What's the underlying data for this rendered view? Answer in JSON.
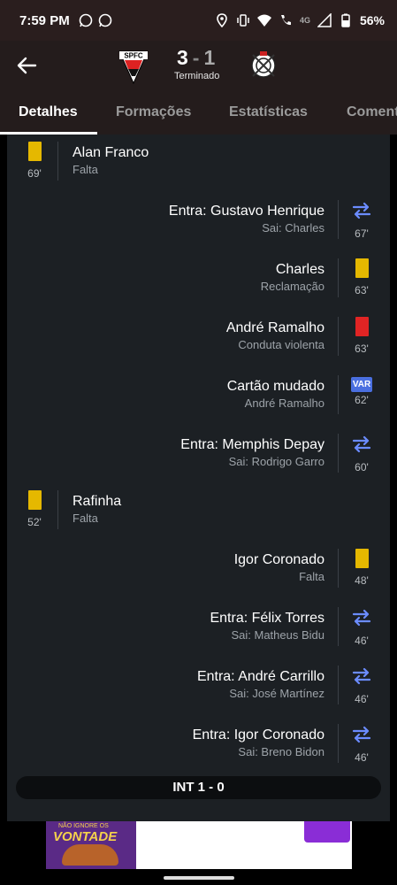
{
  "status_bar": {
    "time": "7:59 PM",
    "network": "4G",
    "battery": "56%"
  },
  "match": {
    "home_score": "3",
    "separator": "-",
    "away_score": "1",
    "status": "Terminado",
    "home_crest_text": "SPFC"
  },
  "tabs": [
    {
      "label": "Detalhes",
      "active": true
    },
    {
      "label": "Formações",
      "active": false
    },
    {
      "label": "Estatísticas",
      "active": false
    },
    {
      "label": "Comentários",
      "active": false
    }
  ],
  "events": [
    {
      "side": "left",
      "type": "yellow-card",
      "title": "Alan Franco",
      "sub": "Falta",
      "minute": "69'"
    },
    {
      "side": "right",
      "type": "substitution",
      "title": "Entra: Gustavo Henrique",
      "sub": "Sai: Charles",
      "minute": "67'"
    },
    {
      "side": "right",
      "type": "yellow-card",
      "title": "Charles",
      "sub": "Reclamação",
      "minute": "63'"
    },
    {
      "side": "right",
      "type": "red-card",
      "title": "André Ramalho",
      "sub": "Conduta violenta",
      "minute": "63'"
    },
    {
      "side": "right",
      "type": "var",
      "title": "Cartão mudado",
      "sub": "André Ramalho",
      "minute": "62'",
      "badge": "VAR"
    },
    {
      "side": "right",
      "type": "substitution",
      "title": "Entra: Memphis Depay",
      "sub": "Sai: Rodrigo Garro",
      "minute": "60'"
    },
    {
      "side": "left",
      "type": "yellow-card",
      "title": "Rafinha",
      "sub": "Falta",
      "minute": "52'"
    },
    {
      "side": "right",
      "type": "yellow-card",
      "title": "Igor Coronado",
      "sub": "Falta",
      "minute": "48'"
    },
    {
      "side": "right",
      "type": "substitution",
      "title": "Entra: Félix Torres",
      "sub": "Sai: Matheus Bidu",
      "minute": "46'"
    },
    {
      "side": "right",
      "type": "substitution",
      "title": "Entra: André Carrillo",
      "sub": "Sai: José Martínez",
      "minute": "46'"
    },
    {
      "side": "right",
      "type": "substitution",
      "title": "Entra: Igor Coronado",
      "sub": "Sai: Breno Bidon",
      "minute": "46'"
    }
  ],
  "interval": "INT 1 - 0",
  "ad": {
    "line1": "NÃO IGNORE OS",
    "line2": "VONTADE"
  },
  "colors": {
    "yellow_card": "#e5b800",
    "red_card": "#e02424",
    "sub_arrows": "#6b8cff",
    "panel": "#1c2024"
  }
}
